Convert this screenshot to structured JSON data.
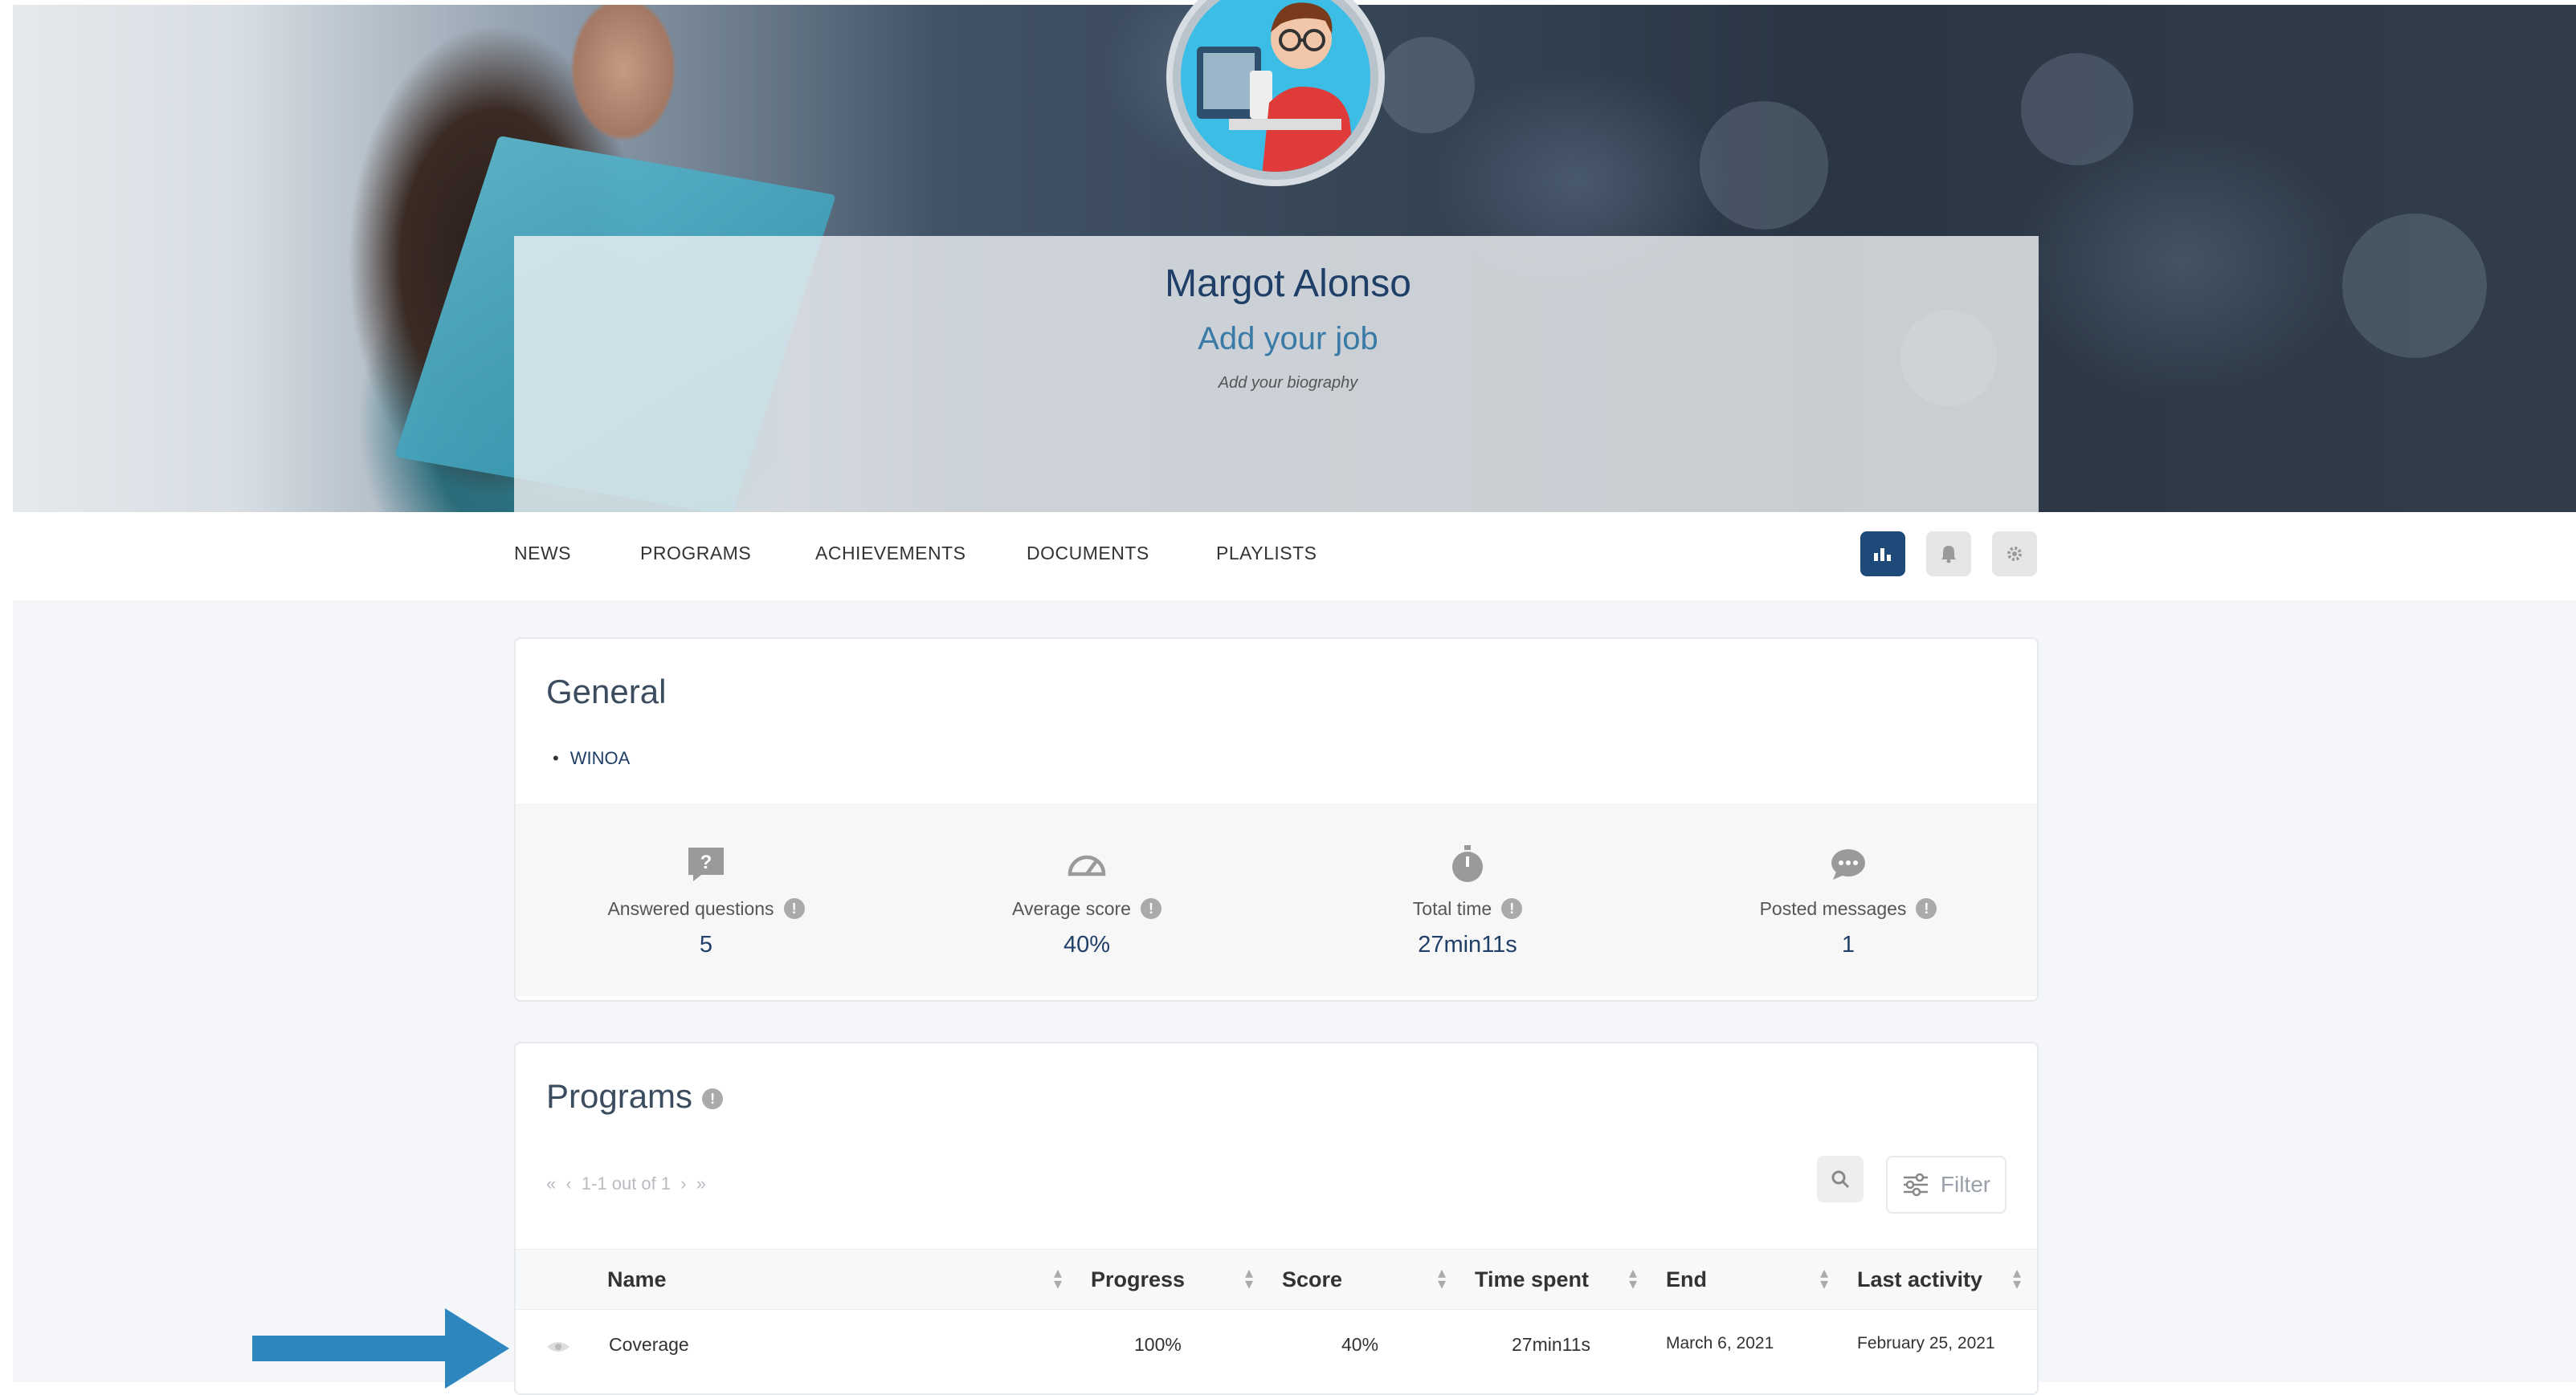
{
  "profile": {
    "name": "Margot Alonso",
    "job": "Add your job",
    "biography": "Add your biography"
  },
  "nav": {
    "items": [
      "NEWS",
      "PROGRAMS",
      "ACHIEVEMENTS",
      "DOCUMENTS",
      "PLAYLISTS"
    ],
    "icons": [
      "bar-chart-icon",
      "bell-icon",
      "gear-icon"
    ],
    "active_icon": "bar-chart-icon"
  },
  "general": {
    "title": "General",
    "groups": [
      "WINOA"
    ],
    "stats": [
      {
        "label": "Answered questions",
        "value": "5",
        "icon": "question-icon"
      },
      {
        "label": "Average score",
        "value": "40%",
        "icon": "gauge-icon"
      },
      {
        "label": "Total time",
        "value": "27min11s",
        "icon": "stopwatch-icon"
      },
      {
        "label": "Posted messages",
        "value": "1",
        "icon": "chat-bubble-icon"
      }
    ]
  },
  "programs": {
    "title": "Programs",
    "pagination": "1-1 out of 1",
    "filter_label": "Filter",
    "columns": [
      "Name",
      "Progress",
      "Score",
      "Time spent",
      "End",
      "Last activity"
    ],
    "rows": [
      {
        "name": "Coverage",
        "progress": "100%",
        "score": "40%",
        "time_spent": "27min11s",
        "end": "March 6, 2021",
        "last_activity": "February 25, 2021"
      }
    ]
  },
  "colors": {
    "primary": "#1f3f68",
    "accent": "#3a7aa6",
    "arrow": "#2e86bf",
    "page_bg": "#f4f6f9"
  }
}
